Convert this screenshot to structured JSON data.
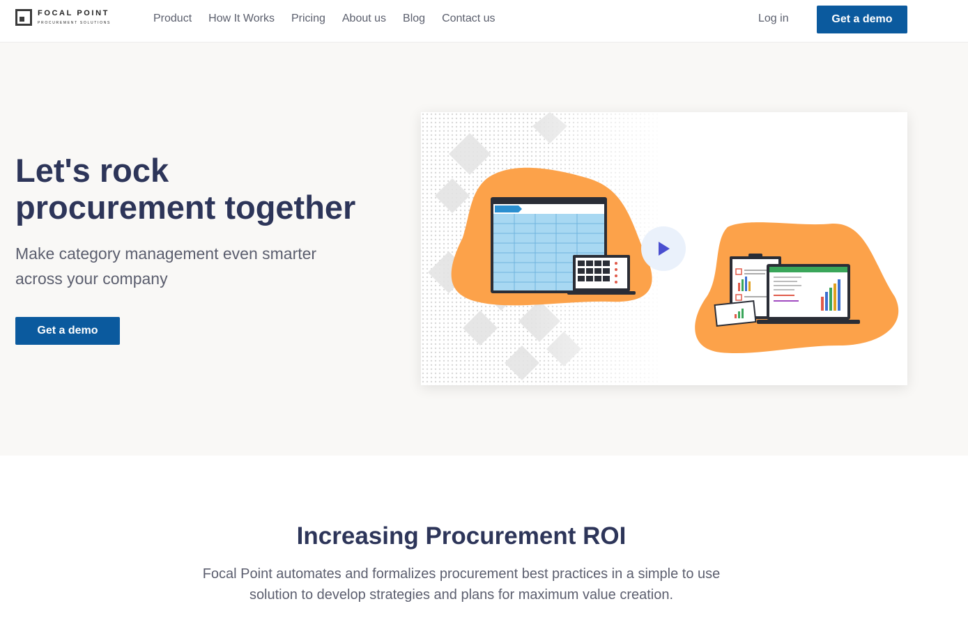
{
  "brand": {
    "name": "FOCAL POINT",
    "tagline": "PROCUREMENT SOLUTIONS"
  },
  "nav": {
    "links": [
      "Product",
      "How It Works",
      "Pricing",
      "About us",
      "Blog",
      "Contact us"
    ],
    "login": "Log in",
    "cta": "Get a demo"
  },
  "hero": {
    "title_line1": "Let's rock",
    "title_line2": "procurement together",
    "subtitle": "Make category management even smarter across your company",
    "cta": "Get a demo"
  },
  "roi": {
    "title": "Increasing Procurement ROI",
    "text": "Focal Point automates and formalizes procurement best practices in a simple to use solution to develop strategies and plans for maximum value creation."
  },
  "colors": {
    "primary_button": "#0b5a9e",
    "heading": "#2d3559",
    "blob_orange": "#fca24a",
    "play_icon": "#4a4fd0"
  },
  "icons": [
    "logo-mark-icon",
    "play-icon"
  ]
}
